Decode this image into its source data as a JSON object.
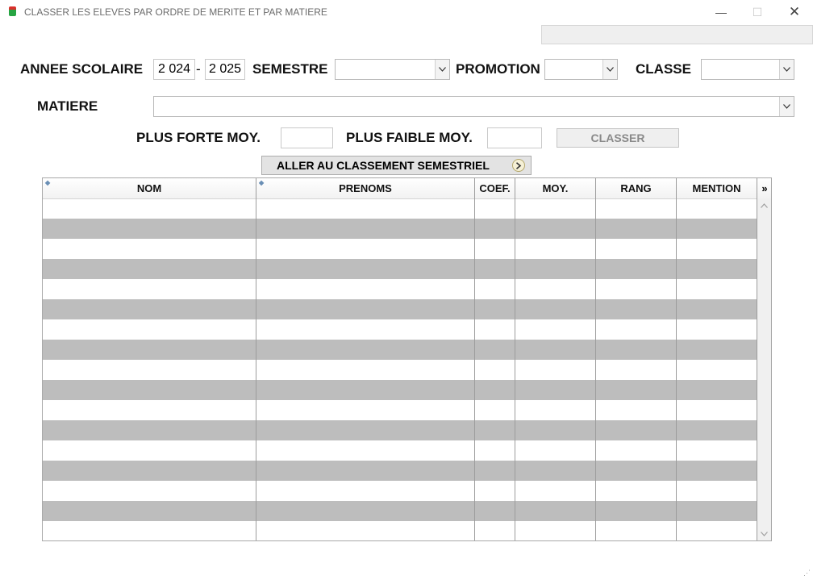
{
  "window": {
    "title": "CLASSER LES ELEVES PAR ORDRE DE MERITE ET PAR MATIERE",
    "minimize": "—",
    "maximize": "☐",
    "close": "✕"
  },
  "filters": {
    "annee_label": "ANNEE SCOLAIRE",
    "annee_start": "2 024",
    "annee_sep": "-",
    "annee_end": "2 025",
    "semestre_label": "SEMESTRE",
    "semestre_value": "",
    "promotion_label": "PROMOTION",
    "promotion_value": "",
    "classe_label": "CLASSE",
    "classe_value": "",
    "matiere_label": "MATIERE",
    "matiere_value": "",
    "plus_forte_label": "PLUS FORTE MOY.",
    "plus_forte_value": "",
    "plus_faible_label": "PLUS FAIBLE MOY.",
    "plus_faible_value": ""
  },
  "buttons": {
    "classer": "CLASSER",
    "aller_classement": "ALLER AU CLASSEMENT SEMESTRIEL"
  },
  "grid": {
    "columns": [
      "NOM",
      "PRENOMS",
      "COEF.",
      "MOY.",
      "RANG",
      "MENTION"
    ],
    "more_columns": "»",
    "rows": []
  },
  "colors": {
    "alt_row": "#bdbdbd",
    "disabled_text": "#8a8a8a"
  }
}
